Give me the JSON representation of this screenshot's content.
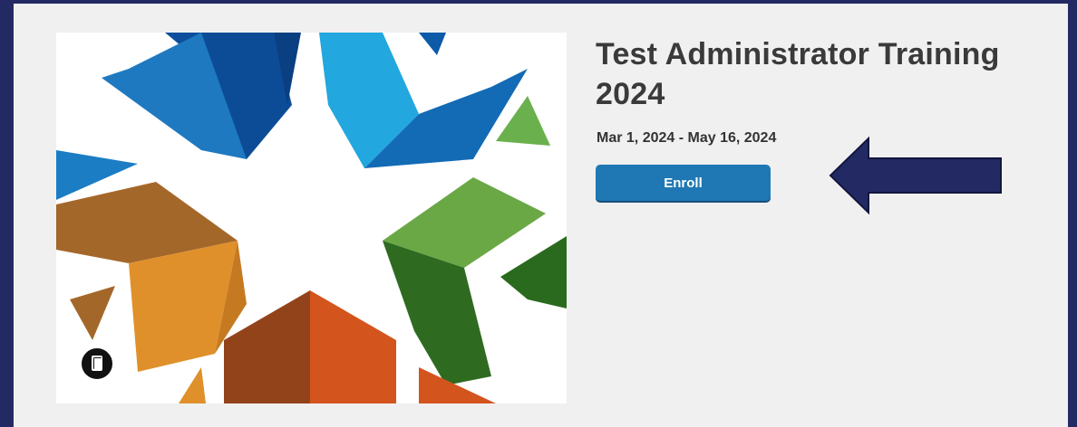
{
  "course": {
    "title": "Test Administrator Training 2024",
    "date_range": "Mar 1, 2024 - May 16, 2024",
    "enroll_label": "Enroll"
  },
  "image": {
    "icon": "star-logo",
    "badge_icon": "book-icon"
  },
  "annotation": {
    "icon": "left-arrow-icon",
    "color": "#232a63"
  },
  "colors": {
    "background": "#232a63",
    "panel": "#f0f0f0",
    "button": "#1f78b4",
    "title_text": "#3a3a3a"
  }
}
